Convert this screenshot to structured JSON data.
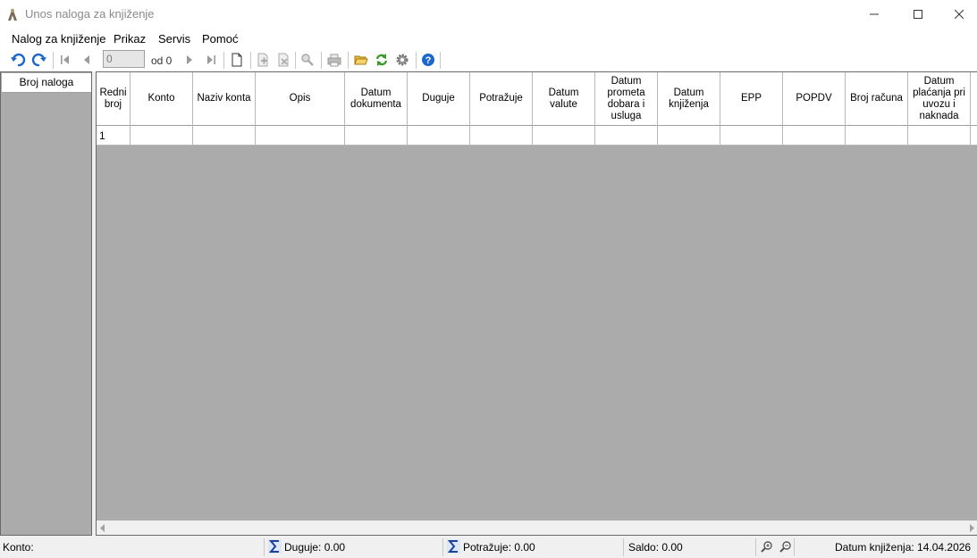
{
  "window": {
    "title": "Unos naloga za knjiženje",
    "minimize_glyph": "—",
    "maximize_glyph": "☐",
    "close_glyph": "✕"
  },
  "menu": [
    "Nalog za knjiženje",
    "Prikaz",
    "Servis",
    "Pomoć"
  ],
  "toolbar": {
    "icons": [
      "undo-icon",
      "redo-icon",
      "first-record-icon",
      "prev-record-icon",
      "next-record-icon",
      "last-record-icon",
      "new-document-icon",
      "add-row-icon",
      "delete-row-icon",
      "search-icon",
      "print-icon",
      "open-folder-icon",
      "refresh-icon",
      "settings-gear-icon",
      "help-icon"
    ],
    "record_number": "0",
    "of_label": "od 0"
  },
  "left_panel": {
    "header": "Broj naloga"
  },
  "grid": {
    "columns": [
      "Redni broj",
      "Konto",
      "Naziv konta",
      "Opis",
      "Datum dokumenta",
      "Duguje",
      "Potražuje",
      "Datum valute",
      "Datum prometa dobara i usluga",
      "Datum knjiženja",
      "EPP",
      "POPDV",
      "Broj računa",
      "Datum plaćanja pri uvozu i naknada"
    ],
    "rows": [
      [
        "1",
        "",
        "",
        "",
        "",
        "",
        "",
        "",
        "",
        "",
        "",
        "",
        "",
        ""
      ]
    ]
  },
  "status": {
    "konto": "Konto:",
    "duguje": "Duguje: 0.00",
    "potrazuje": "Potražuje: 0.00",
    "saldo": "Saldo: 0.00",
    "datum_knjizenja": "Datum knjiženja: 14.04.2026"
  },
  "colors": {
    "accent": "#1c67c9",
    "grid_background": "#ababab",
    "green": "#3a9a2a"
  }
}
